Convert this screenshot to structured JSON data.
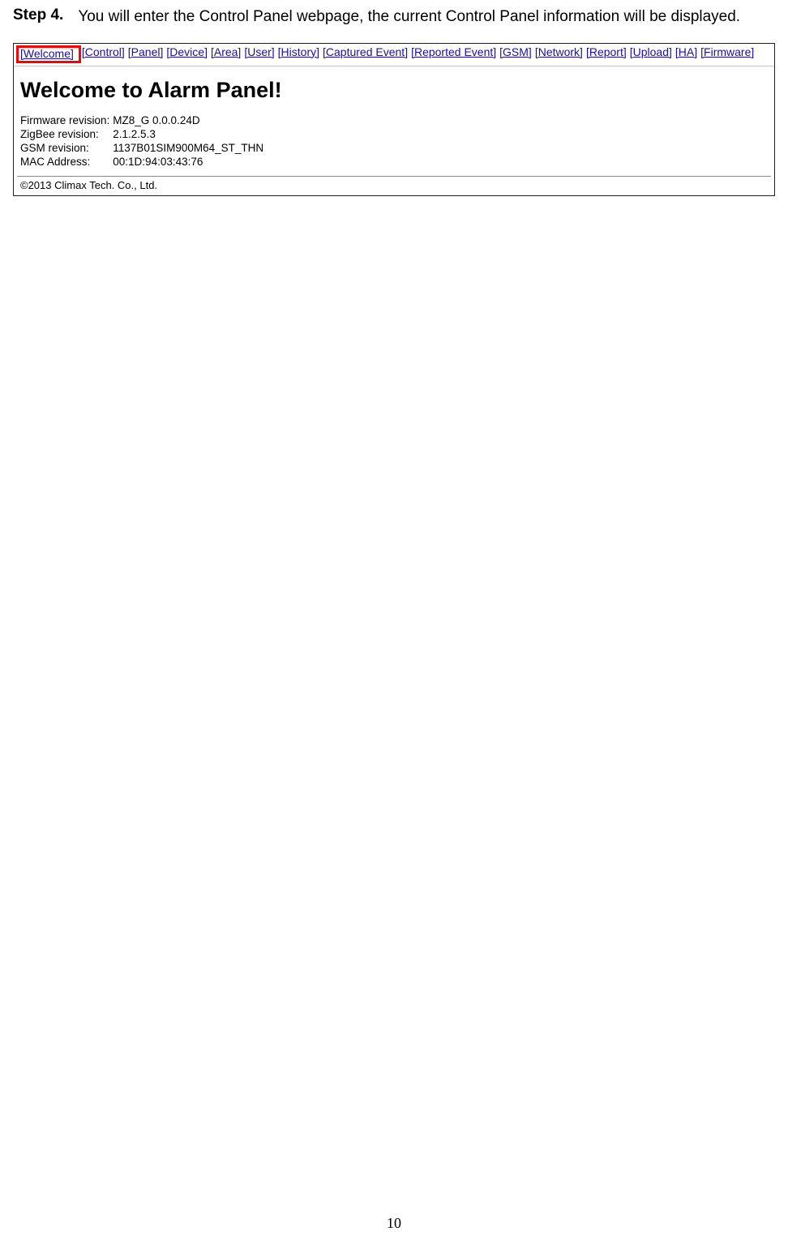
{
  "step": {
    "label": "Step 4.",
    "text": "You will enter the Control Panel webpage, the current Control Panel information will be displayed."
  },
  "nav": {
    "items": [
      "[Welcome]",
      "[Control]",
      "[Panel]",
      "[Device]",
      "[Area]",
      "[User]",
      "[History]",
      "[Captured Event]",
      "[Reported Event]",
      "[GSM]",
      "[Network]",
      "[Report]",
      "[Upload]",
      "[HA]",
      "[Firmware]"
    ]
  },
  "panel": {
    "heading": "Welcome to Alarm Panel!",
    "rows": [
      {
        "label": "Firmware revision:",
        "value": "MZ8_G 0.0.0.24D"
      },
      {
        "label": "ZigBee revision:",
        "value": "2.1.2.5.3"
      },
      {
        "label": "GSM revision:",
        "value": "1137B01SIM900M64_ST_THN"
      },
      {
        "label": "MAC Address:",
        "value": "00:1D:94:03:43:76"
      }
    ],
    "copyright": "©2013 Climax Tech. Co., Ltd."
  },
  "page_number": "10"
}
